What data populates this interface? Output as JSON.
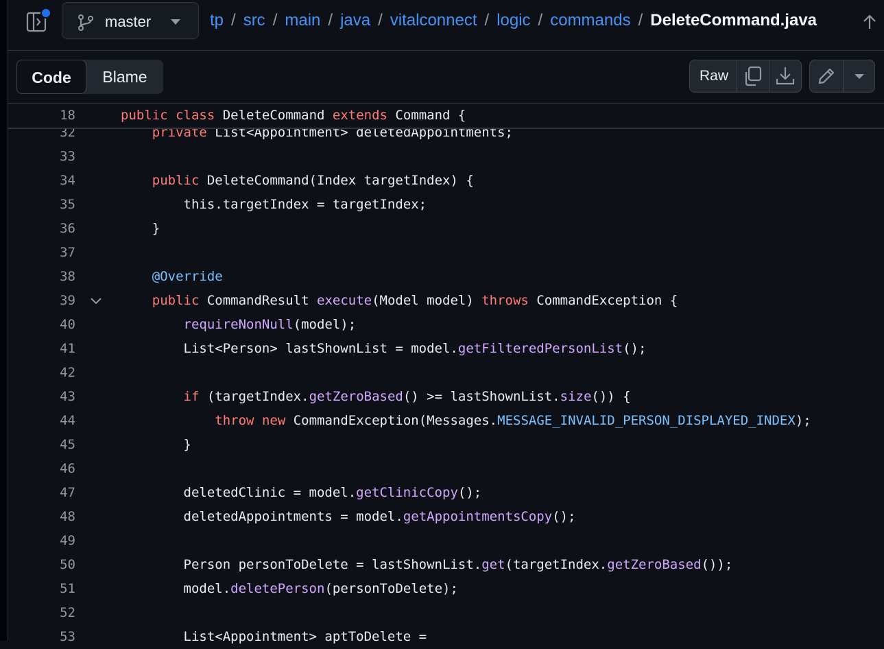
{
  "repo_header": {
    "branch": "master",
    "breadcrumb": [
      "tp",
      "src",
      "main",
      "java",
      "vitalconnect",
      "logic",
      "commands"
    ],
    "separator": "/",
    "file_name": "DeleteCommand.java"
  },
  "toolbar": {
    "code_tab": "Code",
    "blame_tab": "Blame",
    "raw_label": "Raw"
  },
  "sticky_line": {
    "number": "18",
    "tokens": [
      {
        "t": "public",
        "c": "kw"
      },
      {
        "t": " "
      },
      {
        "t": "class",
        "c": "kw"
      },
      {
        "t": " DeleteCommand "
      },
      {
        "t": "extends",
        "c": "kw"
      },
      {
        "t": " Command {"
      }
    ]
  },
  "lines": [
    {
      "n": "32",
      "tokens": [
        {
          "t": "    "
        },
        {
          "t": "private",
          "c": "kw"
        },
        {
          "t": " List<Appointment> deletedAppointments;"
        }
      ]
    },
    {
      "n": "33",
      "tokens": []
    },
    {
      "n": "34",
      "tokens": [
        {
          "t": "    "
        },
        {
          "t": "public",
          "c": "kw"
        },
        {
          "t": " DeleteCommand(Index targetIndex) {"
        }
      ]
    },
    {
      "n": "35",
      "tokens": [
        {
          "t": "        this.targetIndex = targetIndex;"
        }
      ]
    },
    {
      "n": "36",
      "tokens": [
        {
          "t": "    }"
        }
      ]
    },
    {
      "n": "37",
      "tokens": []
    },
    {
      "n": "38",
      "tokens": [
        {
          "t": "    "
        },
        {
          "t": "@Override",
          "c": "cst"
        }
      ]
    },
    {
      "n": "39",
      "fold": true,
      "tokens": [
        {
          "t": "    "
        },
        {
          "t": "public",
          "c": "kw"
        },
        {
          "t": " CommandResult "
        },
        {
          "t": "execute",
          "c": "fn"
        },
        {
          "t": "(Model model) "
        },
        {
          "t": "throws",
          "c": "kw"
        },
        {
          "t": " CommandException {"
        }
      ]
    },
    {
      "n": "40",
      "tokens": [
        {
          "t": "        "
        },
        {
          "t": "requireNonNull",
          "c": "fn"
        },
        {
          "t": "(model);"
        }
      ]
    },
    {
      "n": "41",
      "tokens": [
        {
          "t": "        List<Person> lastShownList = model."
        },
        {
          "t": "getFilteredPersonList",
          "c": "fn"
        },
        {
          "t": "();"
        }
      ]
    },
    {
      "n": "42",
      "tokens": []
    },
    {
      "n": "43",
      "tokens": [
        {
          "t": "        "
        },
        {
          "t": "if",
          "c": "kw"
        },
        {
          "t": " (targetIndex."
        },
        {
          "t": "getZeroBased",
          "c": "fn"
        },
        {
          "t": "() >= lastShownList."
        },
        {
          "t": "size",
          "c": "fn"
        },
        {
          "t": "()) {"
        }
      ]
    },
    {
      "n": "44",
      "tokens": [
        {
          "t": "            "
        },
        {
          "t": "throw",
          "c": "kw"
        },
        {
          "t": " "
        },
        {
          "t": "new",
          "c": "kw"
        },
        {
          "t": " CommandException(Messages."
        },
        {
          "t": "MESSAGE_INVALID_PERSON_DISPLAYED_INDEX",
          "c": "cst"
        },
        {
          "t": ");"
        }
      ]
    },
    {
      "n": "45",
      "tokens": [
        {
          "t": "        }"
        }
      ]
    },
    {
      "n": "46",
      "tokens": []
    },
    {
      "n": "47",
      "tokens": [
        {
          "t": "        deletedClinic = model."
        },
        {
          "t": "getClinicCopy",
          "c": "fn"
        },
        {
          "t": "();"
        }
      ]
    },
    {
      "n": "48",
      "tokens": [
        {
          "t": "        deletedAppointments = model."
        },
        {
          "t": "getAppointmentsCopy",
          "c": "fn"
        },
        {
          "t": "();"
        }
      ]
    },
    {
      "n": "49",
      "tokens": []
    },
    {
      "n": "50",
      "tokens": [
        {
          "t": "        Person personToDelete = lastShownList."
        },
        {
          "t": "get",
          "c": "fn"
        },
        {
          "t": "(targetIndex."
        },
        {
          "t": "getZeroBased",
          "c": "fn"
        },
        {
          "t": "());"
        }
      ]
    },
    {
      "n": "51",
      "tokens": [
        {
          "t": "        model."
        },
        {
          "t": "deletePerson",
          "c": "fn"
        },
        {
          "t": "(personToDelete);"
        }
      ]
    },
    {
      "n": "52",
      "tokens": []
    },
    {
      "n": "53",
      "tokens": [
        {
          "t": "        List<Appointment> aptToDelete ="
        }
      ]
    }
  ],
  "colors": {
    "background": "#0d1117",
    "link": "#4493f8",
    "keyword": "#ff7b72",
    "function": "#d2a8ff",
    "constant": "#79c0ff",
    "notification_dot": "#1f6feb"
  },
  "icons": [
    "sidebar-toggle-icon",
    "git-branch-icon",
    "triangle-down-icon",
    "arrow-up-icon",
    "copy-icon",
    "download-icon",
    "pencil-icon",
    "chevron-down-icon"
  ]
}
